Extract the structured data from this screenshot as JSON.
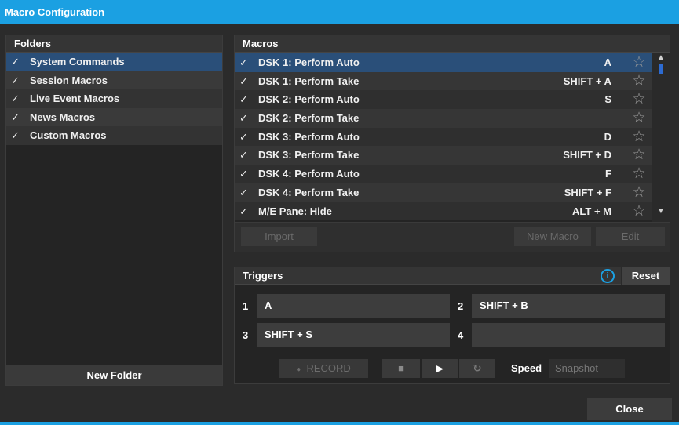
{
  "window": {
    "title": "Macro Configuration"
  },
  "folders": {
    "header": "Folders",
    "items": [
      {
        "label": "System Commands",
        "checked": "✓"
      },
      {
        "label": "Session Macros",
        "checked": "✓"
      },
      {
        "label": "Live Event Macros",
        "checked": "✓"
      },
      {
        "label": "News Macros",
        "checked": "✓"
      },
      {
        "label": "Custom Macros",
        "checked": "✓"
      }
    ],
    "new_folder_label": "New Folder"
  },
  "macros": {
    "header": "Macros",
    "rows": [
      {
        "check": "✓",
        "name": "DSK 1: Perform Auto",
        "hotkey": "A"
      },
      {
        "check": "✓",
        "name": "DSK 1: Perform Take",
        "hotkey": "SHIFT + A"
      },
      {
        "check": "✓",
        "name": "DSK 2: Perform Auto",
        "hotkey": "S"
      },
      {
        "check": "✓",
        "name": "DSK 2: Perform Take",
        "hotkey": ""
      },
      {
        "check": "✓",
        "name": "DSK 3: Perform Auto",
        "hotkey": "D"
      },
      {
        "check": "✓",
        "name": "DSK 3: Perform Take",
        "hotkey": "SHIFT + D"
      },
      {
        "check": "✓",
        "name": "DSK 4: Perform Auto",
        "hotkey": "F"
      },
      {
        "check": "✓",
        "name": "DSK 4: Perform Take",
        "hotkey": "SHIFT + F"
      },
      {
        "check": "✓",
        "name": "M/E Pane: Hide",
        "hotkey": "ALT + M"
      }
    ],
    "import_label": "Import",
    "new_macro_label": "New Macro",
    "edit_label": "Edit"
  },
  "triggers": {
    "header": "Triggers",
    "reset_label": "Reset",
    "info_glyph": "i",
    "slots": [
      {
        "num": "1",
        "value": "A"
      },
      {
        "num": "2",
        "value": "SHIFT + B"
      },
      {
        "num": "3",
        "value": "SHIFT + S"
      },
      {
        "num": "4",
        "value": ""
      }
    ],
    "record_label": "RECORD",
    "speed_label": "Speed",
    "speed_value": "Snapshot"
  },
  "footer": {
    "close_label": "Close"
  },
  "colors": {
    "accent": "#1ba0e2",
    "selection": "#2a4f79"
  }
}
